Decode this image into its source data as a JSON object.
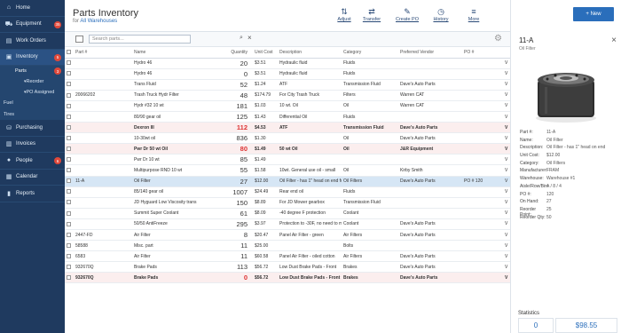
{
  "sidebar": {
    "items": [
      {
        "label": "Home",
        "icon": "home-icon",
        "glyph": "⌂",
        "badge": ""
      },
      {
        "label": "Equipment",
        "icon": "truck-icon",
        "glyph": "⛟",
        "badge": "35"
      },
      {
        "label": "Work Orders",
        "icon": "clipboard-icon",
        "glyph": "▤",
        "badge": ""
      },
      {
        "label": "Inventory",
        "icon": "box-icon",
        "glyph": "▣",
        "badge": "5"
      }
    ],
    "inventory_sub": [
      {
        "label": "Parts",
        "badge": "3"
      },
      {
        "label": "Reorder"
      },
      {
        "label": "PO Assigned"
      }
    ],
    "more_sub": [
      {
        "label": "Fuel"
      },
      {
        "label": "Tires"
      }
    ],
    "items2": [
      {
        "label": "Purchasing",
        "icon": "cart-icon",
        "glyph": "⛁",
        "badge": ""
      },
      {
        "label": "Invoices",
        "icon": "invoice-icon",
        "glyph": "▥",
        "badge": ""
      },
      {
        "label": "People",
        "icon": "people-icon",
        "glyph": "●",
        "badge": "6"
      },
      {
        "label": "Calendar",
        "icon": "calendar-icon",
        "glyph": "▦",
        "badge": ""
      },
      {
        "label": "Reports",
        "icon": "chart-icon",
        "glyph": "▮",
        "badge": ""
      }
    ]
  },
  "header": {
    "title": "Parts Inventory",
    "subtitle_prefix": "for",
    "warehouse": "All Warehouses",
    "toolbar": [
      {
        "label": "Adjust",
        "glyph": "⇅",
        "icon": "adjust-icon"
      },
      {
        "label": "Transfer",
        "glyph": "⇄",
        "icon": "transfer-icon"
      },
      {
        "label": "Create PO",
        "glyph": "✎",
        "icon": "create-po-icon"
      },
      {
        "label": "History",
        "glyph": "◷",
        "icon": "history-icon"
      },
      {
        "label": "More",
        "glyph": "≡",
        "icon": "more-icon"
      }
    ],
    "new_label": "+ New"
  },
  "search": {
    "placeholder": "Search parts..."
  },
  "table": {
    "columns": [
      "",
      "Part #",
      "Name",
      "Quantity",
      "Unit Cost",
      "Description",
      "Category",
      "Preferred Vendor",
      "PO #",
      ""
    ],
    "rows": [
      {
        "part": "",
        "name": "Hydro 46",
        "qty": "20",
        "cost": "$3.51",
        "desc": "Hydraulic fluid",
        "cat": "Fluids",
        "vendor": "",
        "po": "",
        "x": "V",
        "style": ""
      },
      {
        "part": "",
        "name": "Hydro 46",
        "qty": "0",
        "cost": "$3.51",
        "desc": "Hydraulic fluid",
        "cat": "Fluids",
        "vendor": "",
        "po": "",
        "x": "V",
        "style": ""
      },
      {
        "part": "",
        "name": "Trans Fluid",
        "qty": "52",
        "cost": "$1.24",
        "desc": "ATF",
        "cat": "Transmission Fluid",
        "vendor": "Dave's Auto Parts",
        "po": "",
        "x": "V",
        "style": ""
      },
      {
        "part": "20066202",
        "name": "Trash Truck Hydr Filter",
        "qty": "48",
        "cost": "$174.79",
        "desc": "For City Trash Truck",
        "cat": "Filters",
        "vendor": "Warren CAT",
        "po": "",
        "x": "V",
        "style": ""
      },
      {
        "part": "",
        "name": "Hydr #32 10 wt",
        "qty": "181",
        "cost": "$1.03",
        "desc": "10 wt. Oil",
        "cat": "Oil",
        "vendor": "Warren CAT",
        "po": "",
        "x": "V",
        "style": ""
      },
      {
        "part": "",
        "name": "80/90 gear oil",
        "qty": "125",
        "cost": "$1.43",
        "desc": "Differential Oil",
        "cat": "Fluids",
        "vendor": "",
        "po": "",
        "x": "V",
        "style": ""
      },
      {
        "part": "",
        "name": "Dexron III",
        "qty": "112",
        "cost": "$4.53",
        "desc": "ATF",
        "cat": "Transmission Fluid",
        "vendor": "Dave's Auto Parts",
        "po": "",
        "x": "V",
        "style": "hl"
      },
      {
        "part": "",
        "name": "10-30wt oil",
        "qty": "836",
        "cost": "$1.30",
        "desc": "",
        "cat": "Oil",
        "vendor": "Dave's Auto Parts",
        "po": "",
        "x": "V",
        "style": ""
      },
      {
        "part": "",
        "name": "Pwr Dr 50 wt Oil",
        "qty": "80",
        "cost": "$1.49",
        "desc": "50 wt Oil",
        "cat": "Oil",
        "vendor": "J&R Equipment",
        "po": "",
        "x": "V",
        "style": "hl"
      },
      {
        "part": "",
        "name": "Pwr Dr 10 wt",
        "qty": "85",
        "cost": "$1.49",
        "desc": "",
        "cat": "",
        "vendor": "",
        "po": "",
        "x": "V",
        "style": ""
      },
      {
        "part": "",
        "name": "Multipurpose RND 10 wt",
        "qty": "55",
        "cost": "$1.58",
        "desc": "10wt. General use oil - small",
        "cat": "Oil",
        "vendor": "Kirby Smith",
        "po": "",
        "x": "V",
        "style": ""
      },
      {
        "part": "11-A",
        "name": "Oil Filter",
        "qty": "27",
        "cost": "$12.00",
        "desc": "Oil Filter - has 1\" head on end for",
        "cat": "Oil Filters",
        "vendor": "Dave's Auto Parts",
        "po": "PO # 120",
        "x": "V",
        "style": "sel"
      },
      {
        "part": "",
        "name": "85/140 gear oil",
        "qty": "1007",
        "cost": "$24.49",
        "desc": "Rear end oil",
        "cat": "Fluids",
        "vendor": "",
        "po": "",
        "x": "V",
        "style": ""
      },
      {
        "part": "",
        "name": "JD Hyguard Low Viscosity trans",
        "qty": "150",
        "cost": "$8.89",
        "desc": "For JD Mower gearbox",
        "cat": "Transmission Fluid",
        "vendor": "",
        "po": "",
        "x": "V",
        "style": ""
      },
      {
        "part": "",
        "name": "Summit Super Coolant",
        "qty": "61",
        "cost": "$8.09",
        "desc": "-40 degree F protection",
        "cat": "Coolant",
        "vendor": "",
        "po": "",
        "x": "V",
        "style": ""
      },
      {
        "part": "",
        "name": "50/50 AntiFreeze",
        "qty": "295",
        "cost": "$3.97",
        "desc": "Protection to -30F, no need to mix",
        "cat": "Coolant",
        "vendor": "Dave's Auto Parts",
        "po": "",
        "x": "V",
        "style": ""
      },
      {
        "part": "2447-FD",
        "name": "Air Filter",
        "qty": "8",
        "cost": "$20.47",
        "desc": "Panel Air Filter - green",
        "cat": "Air Filters",
        "vendor": "Dave's Auto Parts",
        "po": "",
        "x": "V",
        "style": ""
      },
      {
        "part": "58588",
        "name": "Misc. part",
        "qty": "11",
        "cost": "$25.00",
        "desc": "",
        "cat": "Bolts",
        "vendor": "",
        "po": "",
        "x": "V",
        "style": ""
      },
      {
        "part": "6583",
        "name": "Air Filter",
        "qty": "11",
        "cost": "$60.58",
        "desc": "Panel Air Filter - oiled cotton",
        "cat": "Air Filters",
        "vendor": "Dave's Auto Parts",
        "po": "",
        "x": "V",
        "style": ""
      },
      {
        "part": "932670Q",
        "name": "Brake Pads",
        "qty": "113",
        "cost": "$56.72",
        "desc": "Low Dust Brake Pads - Front",
        "cat": "Brakes",
        "vendor": "Dave's Auto Parts",
        "po": "",
        "x": "V",
        "style": ""
      },
      {
        "part": "932670Q",
        "name": "Brake Pads",
        "qty": "0",
        "cost": "$56.72",
        "desc": "Low Dust Brake Pads - Front",
        "cat": "Brakes",
        "vendor": "Dave's Auto Parts",
        "po": "",
        "x": "V",
        "style": "hl"
      }
    ]
  },
  "detail": {
    "title": "11-A",
    "subtitle": "Oil Filter",
    "fields": [
      {
        "k": "Part #:",
        "v": "11-A"
      },
      {
        "k": "Name:",
        "v": "Oil Filter"
      },
      {
        "k": "Description:",
        "v": "Oil Filter - has 1\" head on end"
      },
      {
        "k": "Unit Cost:",
        "v": "$12.00"
      },
      {
        "k": "Category:",
        "v": "Oil Filters"
      },
      {
        "k": "Manufacturer:",
        "v": "FRAM"
      },
      {
        "k": "Warehouse:",
        "v": "Warehouse #1"
      },
      {
        "k": "Aisle/Row/Bin:",
        "v": "A / 8 / 4"
      },
      {
        "k": "PO #:",
        "v": "120"
      },
      {
        "k": "On Hand:",
        "v": "27"
      },
      {
        "k": "Reorder Point:",
        "v": "25"
      },
      {
        "k": "Reorder Qty:",
        "v": "50"
      }
    ],
    "stats_label": "Statistics",
    "stat1": "0",
    "stat2": "$98.55"
  },
  "colors": {
    "sidebar": "#1f3a5f",
    "accent": "#2a6ebb",
    "alert": "#d33"
  }
}
